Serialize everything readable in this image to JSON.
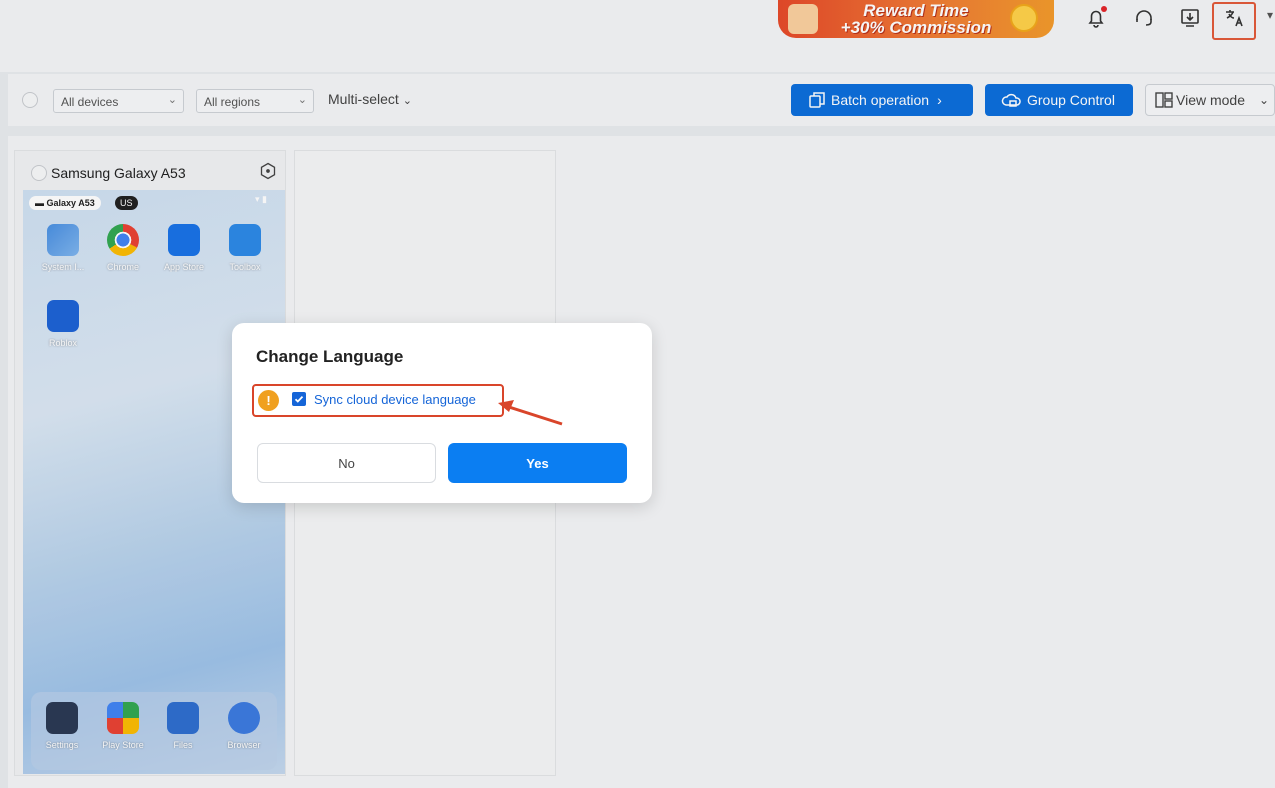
{
  "banner": {
    "line1": "Reward Time",
    "line2": "+30% Commission"
  },
  "header_icons": [
    "bell-icon",
    "headset-icon",
    "download-icon",
    "translate-icon"
  ],
  "toolbar": {
    "device_filter": "All devices",
    "region_filter": "All regions",
    "multi_select": "Multi-select",
    "batch_operation": "Batch operation",
    "group_control": "Group Control",
    "view_mode": "View mode"
  },
  "device": {
    "name": "Samsung Galaxy A53",
    "screen": {
      "device_chip": "Galaxy A53",
      "region_chip": "US",
      "apps": [
        "System I...",
        "Chrome",
        "App Store",
        "Toolbox",
        "Roblox"
      ],
      "dock": [
        "Settings",
        "Play Store",
        "Files",
        "Browser"
      ]
    }
  },
  "dialog": {
    "title": "Change Language",
    "checkbox_label": "Sync cloud device language",
    "checkbox_checked": true,
    "no_label": "No",
    "yes_label": "Yes"
  },
  "colors": {
    "primary": "#0D6FDC",
    "yes_button": "#0B7EF2",
    "warning": "#F0A020",
    "highlight": "#D9452A"
  }
}
